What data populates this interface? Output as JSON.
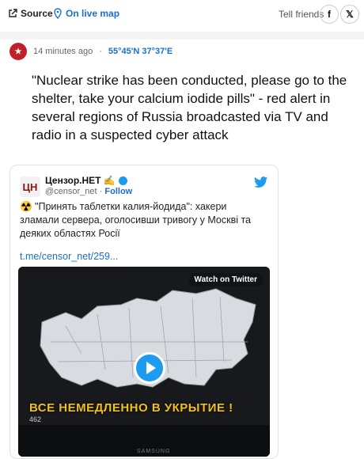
{
  "toolbar": {
    "source_label": "Source",
    "map_label": "On live map",
    "tell_label": "Tell friends",
    "facebook_icon": "f",
    "x_icon": "𝕏"
  },
  "post": {
    "time": "14 minutes ago",
    "separator": "·",
    "coordinates": "55°45'N 37°37'E",
    "headline": "\"Nuclear strike has been conducted, please go to the shelter, take your calcium iodide pills\" - red alert in several regions of Russia broadcasted via TV and radio in a suspected cyber attack"
  },
  "tweet": {
    "logo_text": "ЦН",
    "account_name": "Цензор.НЕТ ✍️",
    "handle": "@censor_net",
    "follow": "Follow",
    "text": "☢️ \"Принять таблетки калия-йодида\": хакери зламали сервера, оголосивши тривогу у Москві та деяких областях Росії",
    "link": "t.me/censor_net/259...",
    "watch_label": "Watch on Twitter",
    "video_caption": "ВСЕ НЕМЕДЛЕННО В УКРЫТИЕ !",
    "video_ticker": "462",
    "video_brand": "SAMSUNG"
  },
  "colors": {
    "link_blue": "#1a6fd1",
    "twitter_blue": "#1d9bf0",
    "avatar_red": "#c0202a",
    "caption_yellow": "#f0c020"
  }
}
